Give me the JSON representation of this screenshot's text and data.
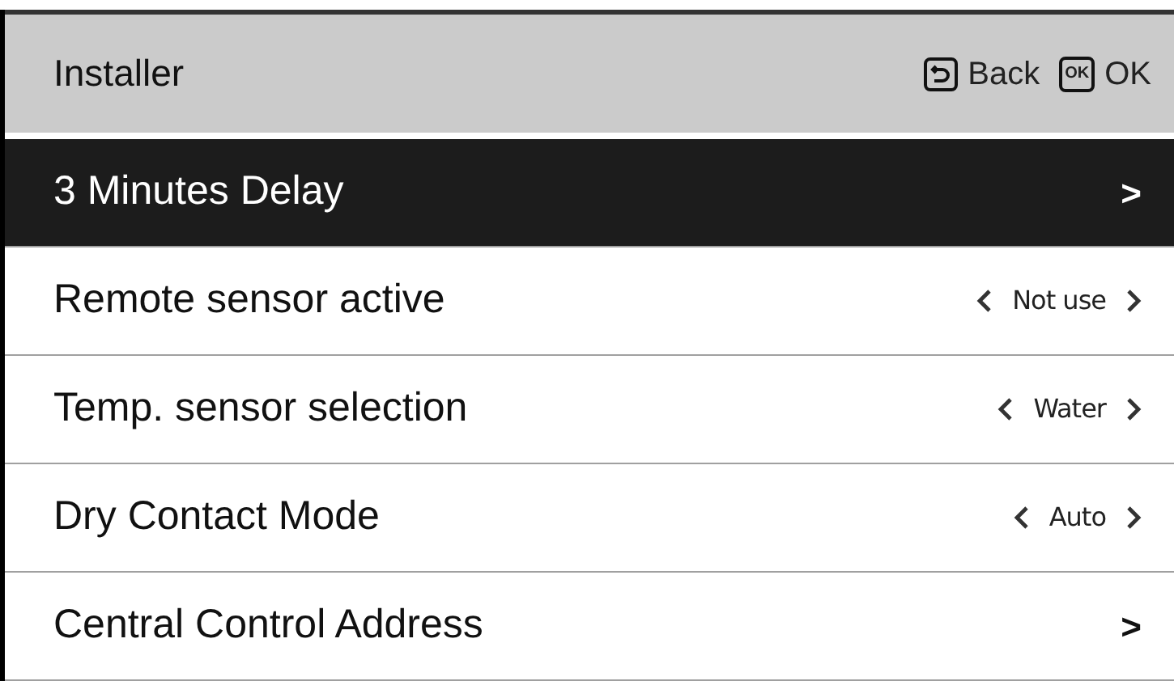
{
  "header": {
    "title": "Installer",
    "buttons": [
      {
        "kind": "back",
        "label": "Back"
      },
      {
        "kind": "ok",
        "label": "OK",
        "key": "OK"
      }
    ]
  },
  "items": [
    {
      "kind": "link",
      "label": "3 Minutes Delay",
      "selected": true,
      "chevron": ">"
    },
    {
      "kind": "option",
      "label": "Remote sensor active",
      "selected": false,
      "value": "Not use"
    },
    {
      "kind": "option",
      "label": "Temp. sensor selection",
      "selected": false,
      "value": "Water"
    },
    {
      "kind": "option",
      "label": "Dry Contact Mode",
      "selected": false,
      "value": "Auto"
    },
    {
      "kind": "link",
      "label": "Central Control Address",
      "selected": false,
      "chevron": ">"
    }
  ]
}
